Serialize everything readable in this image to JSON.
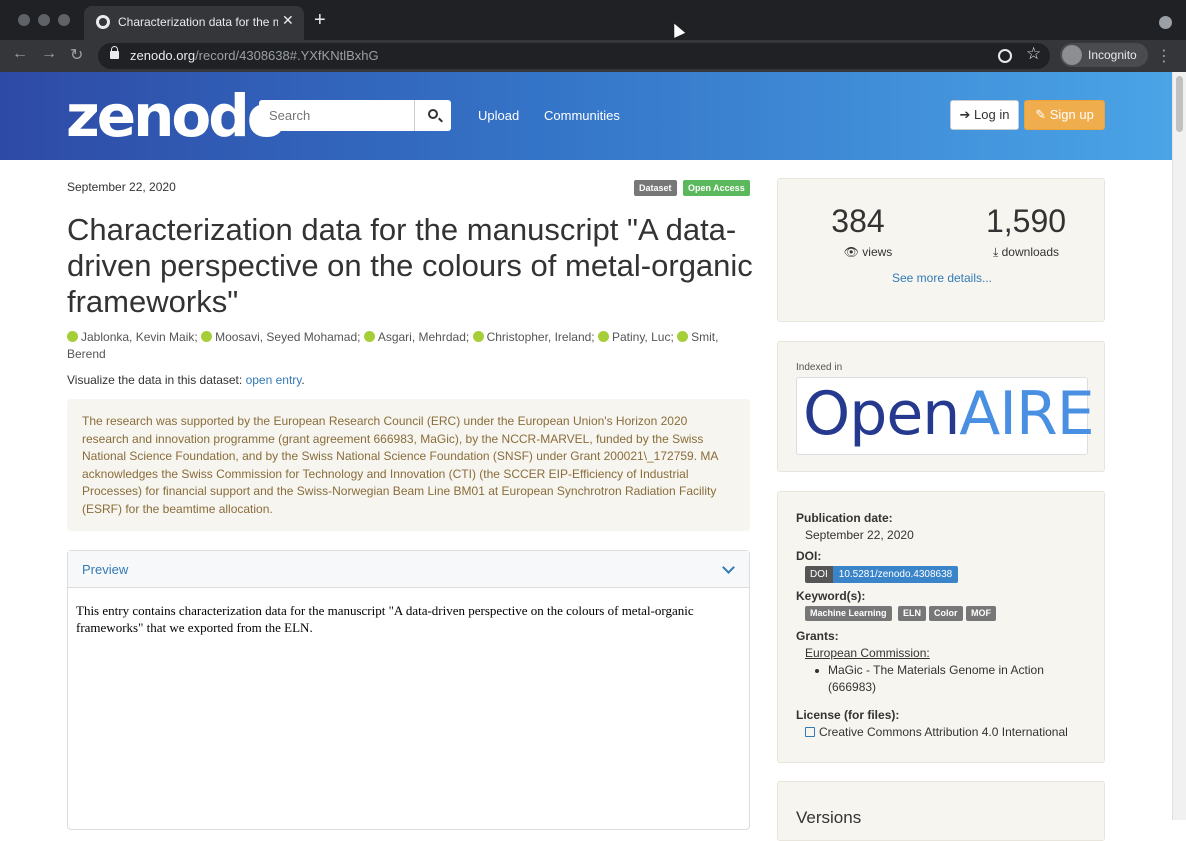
{
  "browser": {
    "tab_title": "Characterization data for the m",
    "url_domain": "zenodo.org",
    "url_path": "/record/4308638#.YXfKNtlBxhG",
    "incognito_label": "Incognito"
  },
  "header": {
    "logo": "zenodo",
    "search_placeholder": "Search",
    "nav": [
      "Upload",
      "Communities"
    ],
    "login": "Log in",
    "signup": "Sign up"
  },
  "record": {
    "date": "September 22, 2020",
    "badges": [
      {
        "label": "Dataset",
        "color": "#777777"
      },
      {
        "label": "Open Access",
        "color": "#5cb85c"
      }
    ],
    "title": "Characterization data for the manuscript \"A data-driven perspective on the colours of metal-organic frameworks\"",
    "authors": [
      "Jablonka, Kevin Maik;",
      "Moosavi, Seyed Mohamad;",
      "Asgari, Mehrdad;",
      "Christopher, Ireland;",
      "Patiny, Luc;",
      "Smit, Berend"
    ],
    "visualize_text": "Visualize the data in this dataset: ",
    "visualize_link": "open entry",
    "visualize_end": ".",
    "funding_notice": "The research was supported by the European Research Council (ERC) under the European Union's Horizon 2020 research and innovation programme (grant agreement 666983, MaGic), by the NCCR-MARVEL, funded by the Swiss National Science Foundation, and by the Swiss National Science Foundation (SNSF) under Grant 200021\\_172759. MA acknowledges the Swiss Commission for Technology and Innovation (CTI) (the SCCER EIP-Efficiency of Industrial Processes) for financial support and the Swiss-Norwegian Beam Line BM01 at European Synchrotron Radiation Facility (ESRF) for the beamtime allocation.",
    "preview_title": "Preview",
    "preview_text": "This entry contains characterization data for the manuscript \"A data-driven perspective on the colours of metal-organic frameworks\" that we exported from the ELN."
  },
  "stats": {
    "views": "384",
    "views_label": "views",
    "downloads": "1,590",
    "downloads_label": "downloads",
    "see_more": "See more details..."
  },
  "indexed": {
    "label": "Indexed in",
    "logo_open": "Open",
    "logo_aire": "AIRE"
  },
  "metadata": {
    "pub_date_label": "Publication date:",
    "pub_date": "September 22, 2020",
    "doi_label": "DOI:",
    "doi_tag": "DOI",
    "doi_value": "10.5281/zenodo.4308638",
    "keywords_label": "Keyword(s):",
    "keywords": [
      "Machine Learning",
      "ELN",
      "Color",
      "MOF"
    ],
    "grants_label": "Grants:",
    "grant_funder": "European Commission:",
    "grant_item": "MaGic - The Materials Genome in Action (666983)",
    "license_label": "License (for files):",
    "license": "Creative Commons Attribution 4.0 International"
  },
  "versions": {
    "title": "Versions"
  }
}
